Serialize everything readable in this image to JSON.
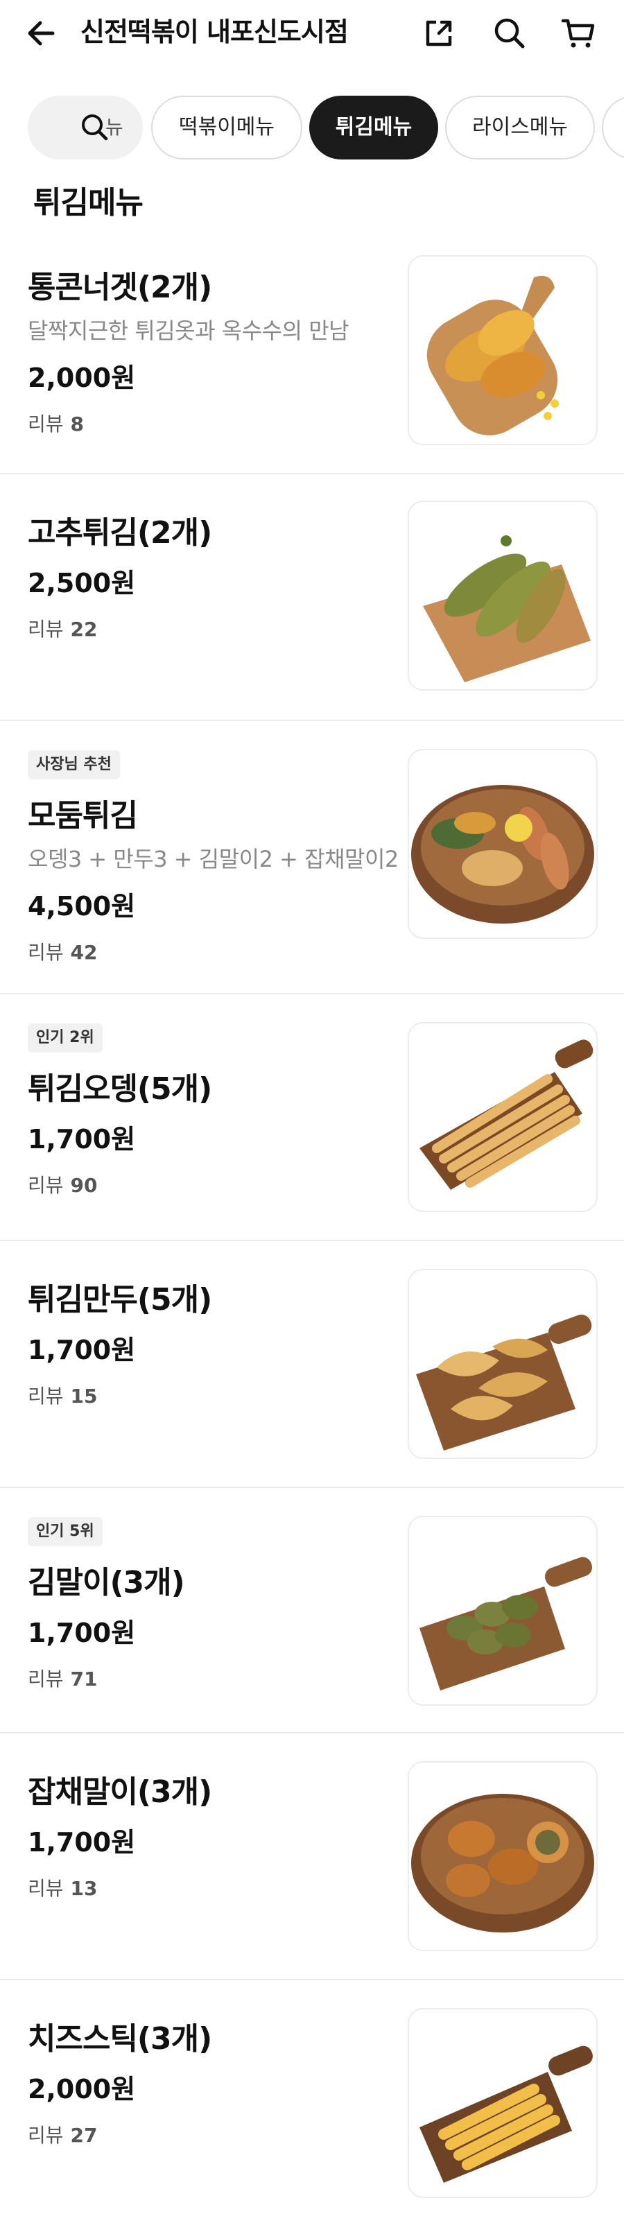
{
  "header": {
    "title": "신전떡볶이 내포신도시점",
    "back_icon": "arrow-left-icon",
    "share_icon": "share-icon",
    "search_icon": "search-icon",
    "cart_icon": "cart-icon"
  },
  "tabs": {
    "search_icon": "search-icon",
    "partial_label": "뉴",
    "items": [
      {
        "label": "떡볶이메뉴",
        "active": false
      },
      {
        "label": "튀김메뉴",
        "active": true
      },
      {
        "label": "라이스메뉴",
        "active": false
      },
      {
        "label": "",
        "active": false
      }
    ]
  },
  "section": {
    "title": "튀김메뉴"
  },
  "review_label": "리뷰",
  "menu": [
    {
      "name": "통콘너겟(2개)",
      "badge": "",
      "description": "달짝지근한 튀김옷과 옥수수의 만남",
      "price": "2,000원",
      "reviews": "8"
    },
    {
      "name": "고추튀김(2개)",
      "badge": "",
      "description": "",
      "price": "2,500원",
      "reviews": "22"
    },
    {
      "name": "모둠튀김",
      "badge": "사장님 추천",
      "description": "오뎅3 + 만두3 + 김말이2 + 잡채말이2",
      "price": "4,500원",
      "reviews": "42"
    },
    {
      "name": "튀김오뎅(5개)",
      "badge": "인기 2위",
      "description": "",
      "price": "1,700원",
      "reviews": "90"
    },
    {
      "name": "튀김만두(5개)",
      "badge": "",
      "description": "",
      "price": "1,700원",
      "reviews": "15"
    },
    {
      "name": "김말이(3개)",
      "badge": "인기 5위",
      "description": "",
      "price": "1,700원",
      "reviews": "71"
    },
    {
      "name": "잡채말이(3개)",
      "badge": "",
      "description": "",
      "price": "1,700원",
      "reviews": "13"
    },
    {
      "name": "치즈스틱(3개)",
      "badge": "",
      "description": "",
      "price": "2,000원",
      "reviews": "27"
    }
  ],
  "colors": {
    "accent": "#1b1b1b",
    "board": "#b07a44",
    "fried": "#d89a3a"
  }
}
